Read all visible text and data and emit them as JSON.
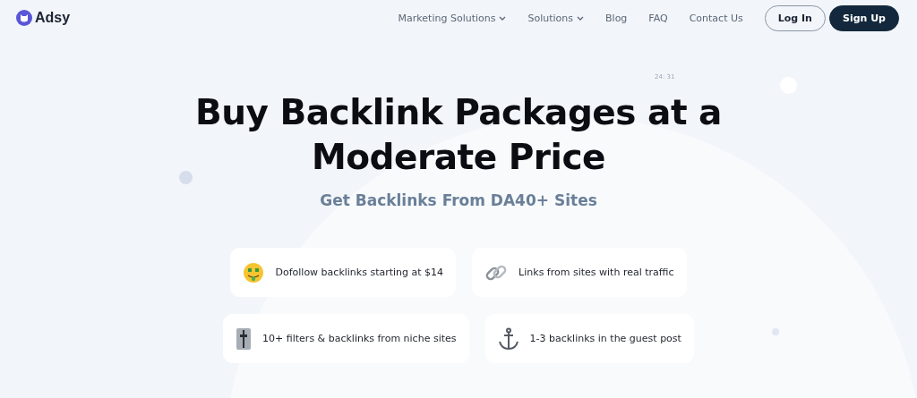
{
  "brand": {
    "name": "Adsy"
  },
  "nav": [
    {
      "label": "Marketing Solutions",
      "dropdown": true
    },
    {
      "label": "Solutions",
      "dropdown": true
    },
    {
      "label": "Blog",
      "dropdown": false
    },
    {
      "label": "FAQ",
      "dropdown": false
    },
    {
      "label": "Contact Us",
      "dropdown": false
    }
  ],
  "auth": {
    "login": "Log In",
    "signup": "Sign Up"
  },
  "hero": {
    "note": "24: 31",
    "title_lines": [
      "Buy Backlink Packages at a",
      "Moderate Price"
    ],
    "subtitle": "Get Backlinks From DA40+ Sites"
  },
  "feature_rows": [
    [
      {
        "kind": "money",
        "text": "Dofollow backlinks starting at $14"
      },
      {
        "kind": "chain",
        "text": "Links from sites with real traffic"
      }
    ],
    [
      {
        "kind": "filter",
        "text": "10+ filters & backlinks from niche sites"
      },
      {
        "kind": "anchor",
        "text": "1-3 backlinks in the guest post"
      }
    ]
  ]
}
